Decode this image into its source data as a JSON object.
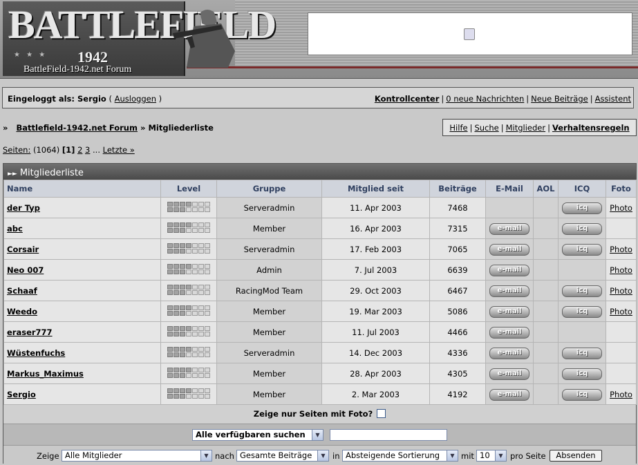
{
  "banner": {
    "logo_title": "BATTLEFIELD",
    "logo_year": "1942",
    "logo_sub": "BattleField-1942.net Forum"
  },
  "login": {
    "prefix": "Eingeloggt als:",
    "user": "Sergio",
    "logout": "Ausloggen",
    "links": [
      "Kontrollcenter",
      "0 neue Nachrichten",
      "Neue Beiträge",
      "Assistent"
    ]
  },
  "breadcrumb": {
    "prefix": "»",
    "forum": "Battlefield-1942.net Forum",
    "sep": "»",
    "current": "Mitgliederliste"
  },
  "nav": {
    "links": [
      "Hilfe",
      "Suche",
      "Mitglieder",
      "Verhaltensregeln"
    ]
  },
  "pagination": {
    "label": "Seiten:",
    "total": "(1064)",
    "current": "[1]",
    "pages": [
      "2",
      "3"
    ],
    "ellipsis": "...",
    "last": "Letzte »"
  },
  "table": {
    "title": "Mitgliederliste",
    "headers": [
      "Name",
      "Level",
      "Gruppe",
      "Mitglied seit",
      "Beiträge",
      "E-Mail",
      "AOL",
      "ICQ",
      "Foto"
    ],
    "email_label": "e-mail",
    "icq_label": "icq",
    "rows": [
      {
        "name": "der Typ",
        "group": "Serveradmin",
        "since": "11. Apr 2003",
        "posts": "7468",
        "email": false,
        "icq": true,
        "foto": "Photo"
      },
      {
        "name": "abc",
        "group": "Member",
        "since": "16. Apr 2003",
        "posts": "7315",
        "email": true,
        "icq": true,
        "foto": ""
      },
      {
        "name": "Corsair",
        "group": "Serveradmin",
        "since": "17. Feb 2003",
        "posts": "7065",
        "email": true,
        "icq": true,
        "foto": "Photo"
      },
      {
        "name": "Neo 007",
        "group": "Admin",
        "since": "7. Jul 2003",
        "posts": "6639",
        "email": true,
        "icq": false,
        "foto": "Photo"
      },
      {
        "name": "Schaaf",
        "group": "RacingMod Team",
        "since": "29. Oct 2003",
        "posts": "6467",
        "email": true,
        "icq": true,
        "foto": "Photo"
      },
      {
        "name": "Weedo",
        "group": "Member",
        "since": "19. Mar 2003",
        "posts": "5086",
        "email": true,
        "icq": true,
        "foto": "Photo"
      },
      {
        "name": "eraser777",
        "group": "Member",
        "since": "11. Jul 2003",
        "posts": "4466",
        "email": true,
        "icq": false,
        "foto": ""
      },
      {
        "name": "Wüstenfuchs",
        "group": "Serveradmin",
        "since": "14. Dec 2003",
        "posts": "4336",
        "email": true,
        "icq": true,
        "foto": ""
      },
      {
        "name": "Markus_Maximus",
        "group": "Member",
        "since": "28. Apr 2003",
        "posts": "4305",
        "email": true,
        "icq": true,
        "foto": ""
      },
      {
        "name": "Sergio",
        "group": "Member",
        "since": "2. Mar 2003",
        "posts": "4192",
        "email": true,
        "icq": true,
        "foto": "Photo"
      }
    ]
  },
  "filters": {
    "photo_only": "Zeige nur Seiten mit Foto?",
    "search_select": "Alle verfügbaren suchen",
    "search_value": "",
    "show_label": "Zeige",
    "members_select": "Alle Mitglieder",
    "by_label": "nach",
    "sort_field_select": "Gesamte Beiträge",
    "in_label": "in",
    "sort_order_select": "Absteigende Sortierung",
    "with_label": "mit",
    "per_page_select": "10",
    "per_page_label": "pro Seite",
    "submit": "Absenden"
  }
}
